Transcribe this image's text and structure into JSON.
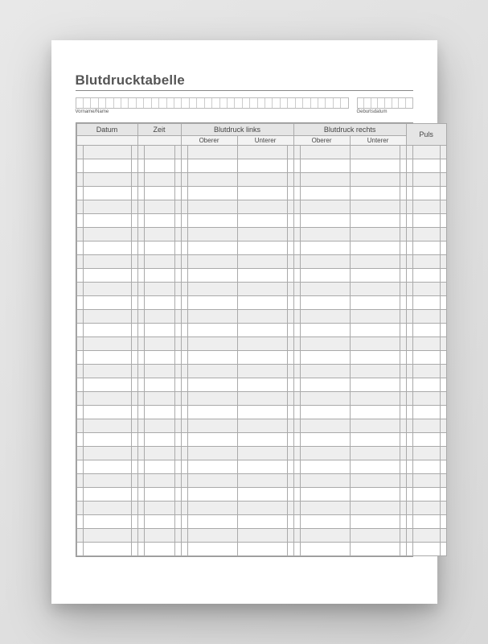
{
  "title": "Blutdrucktabelle",
  "fields": {
    "name_label": "Vorname/Name",
    "dob_label": "Geburtsdatum"
  },
  "columns": {
    "datum": "Datum",
    "zeit": "Zeit",
    "links": "Blutdruck links",
    "rechts": "Blutdruck rechts",
    "oberer": "Oberer",
    "unterer": "Unterer",
    "puls": "Puls"
  },
  "row_count": 30,
  "name_cells": 36,
  "dob_cells": 8
}
